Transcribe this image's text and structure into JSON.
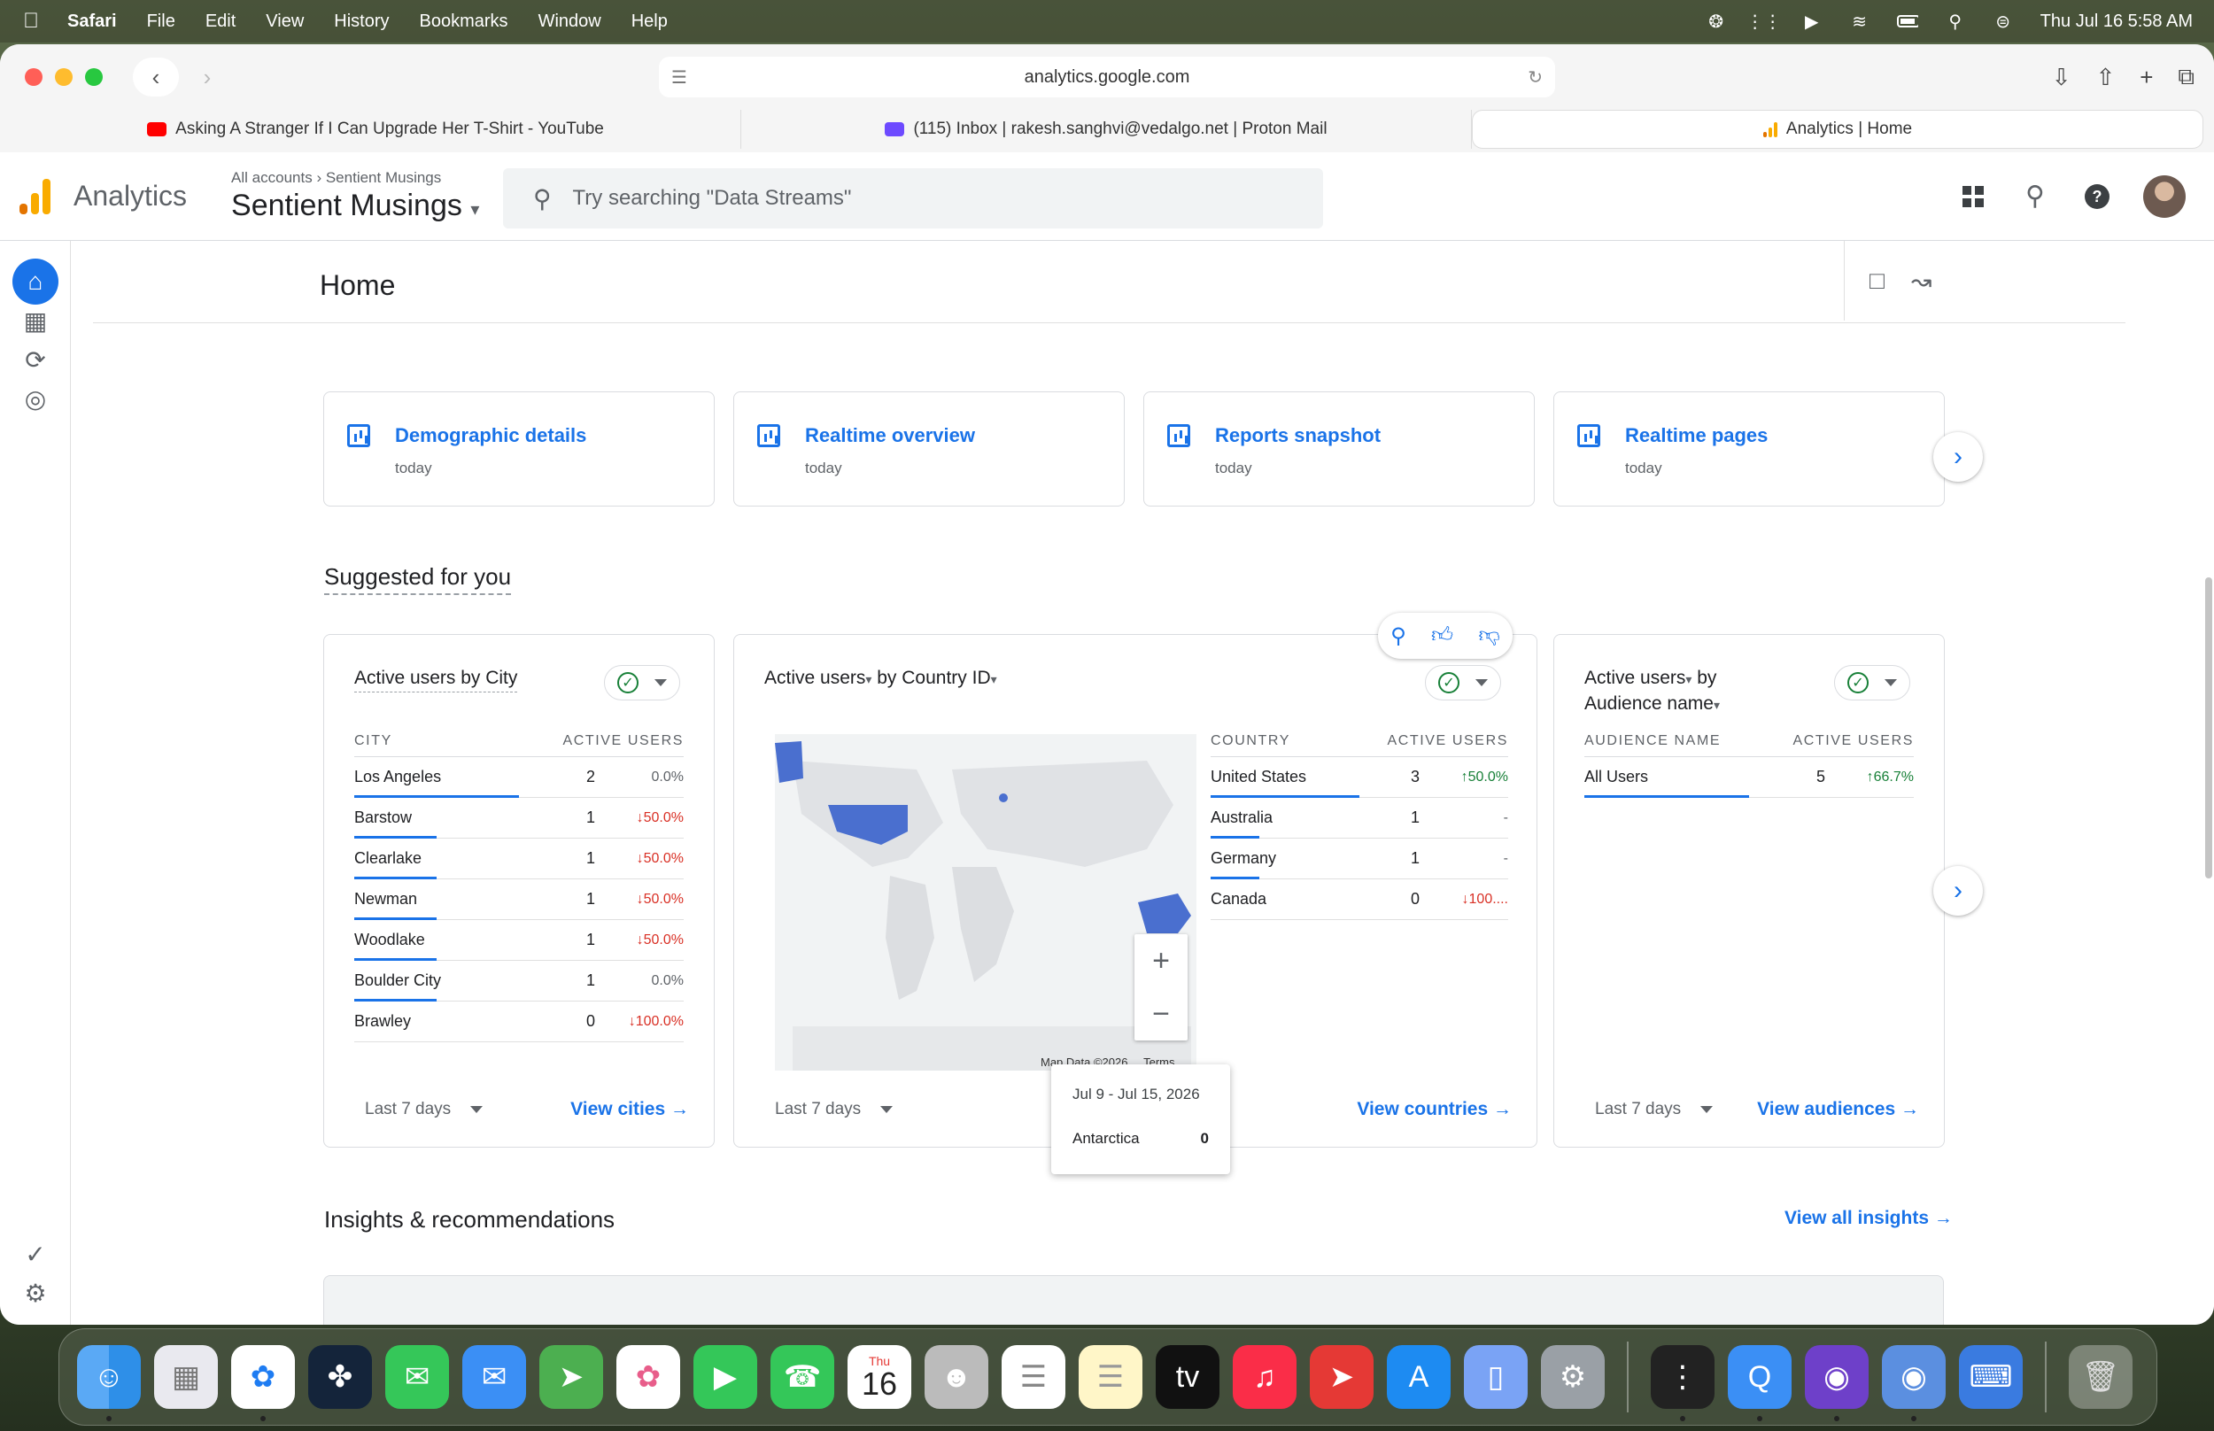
{
  "menubar": {
    "app": "Safari",
    "items": [
      "File",
      "Edit",
      "View",
      "History",
      "Bookmarks",
      "Window",
      "Help"
    ],
    "clock": "Thu Jul 16  5:58 AM"
  },
  "browser": {
    "url": "analytics.google.com",
    "tabs": [
      {
        "title": "Asking A Stranger If I Can Upgrade Her T-Shirt - YouTube",
        "icon": "youtube-icon",
        "color": "#ff0000"
      },
      {
        "title": "(115) Inbox | rakesh.sanghvi@vedalgo.net | Proton Mail",
        "icon": "proton-mail-icon",
        "color": "#6d4aff"
      },
      {
        "title": "Analytics | Home",
        "icon": "analytics-icon",
        "color": "#f9ab00"
      }
    ]
  },
  "header": {
    "product": "Analytics",
    "crumb_all": "All accounts",
    "crumb_account": "Sentient Musings",
    "property": "Sentient Musings",
    "search_placeholder": "Try searching \"Data Streams\""
  },
  "home": {
    "title": "Home",
    "quick_cards": [
      {
        "title": "Demographic details",
        "sub": "today"
      },
      {
        "title": "Realtime overview",
        "sub": "today"
      },
      {
        "title": "Reports snapshot",
        "sub": "today"
      },
      {
        "title": "Realtime pages",
        "sub": "today"
      }
    ],
    "suggested_title": "Suggested for you",
    "city_card": {
      "title": "Active users by City",
      "col1": "CITY",
      "col2": "ACTIVE USERS",
      "rows": [
        {
          "name": "Los Angeles",
          "value": "2",
          "change": "0.0%",
          "dir": "neutral",
          "share": 1.0
        },
        {
          "name": "Barstow",
          "value": "1",
          "change": "↓50.0%",
          "dir": "down",
          "share": 0.5
        },
        {
          "name": "Clearlake",
          "value": "1",
          "change": "↓50.0%",
          "dir": "down",
          "share": 0.5
        },
        {
          "name": "Newman",
          "value": "1",
          "change": "↓50.0%",
          "dir": "down",
          "share": 0.5
        },
        {
          "name": "Woodlake",
          "value": "1",
          "change": "↓50.0%",
          "dir": "down",
          "share": 0.5
        },
        {
          "name": "Boulder City",
          "value": "1",
          "change": "0.0%",
          "dir": "neutral",
          "share": 0.5
        },
        {
          "name": "Brawley",
          "value": "0",
          "change": "↓100.0%",
          "dir": "down",
          "share": 0
        }
      ],
      "range": "Last 7 days",
      "link": "View cities"
    },
    "country_card": {
      "title_metric": "Active users",
      "title_dim": "by Country ID",
      "col1": "COUNTRY",
      "col2": "ACTIVE USERS",
      "rows": [
        {
          "name": "United States",
          "value": "3",
          "change": "↑50.0%",
          "dir": "up",
          "share": 1.0
        },
        {
          "name": "Australia",
          "value": "1",
          "change": "-",
          "dir": "neutral",
          "share": 0.33
        },
        {
          "name": "Germany",
          "value": "1",
          "change": "-",
          "dir": "neutral",
          "share": 0.33
        },
        {
          "name": "Canada",
          "value": "0",
          "change": "↓100....",
          "dir": "down",
          "share": 0
        }
      ],
      "map_attribution": "Map Data ©2026",
      "map_terms": "Terms",
      "tooltip_dates": "Jul 9 - Jul 15, 2026",
      "tooltip_region": "Antarctica",
      "tooltip_value": "0",
      "range": "Last 7 days",
      "link": "View countries"
    },
    "audience_card": {
      "title_metric": "Active users",
      "title_dim": "by",
      "title_dim2": "Audience name",
      "col1": "AUDIENCE NAME",
      "col2": "ACTIVE USERS",
      "rows": [
        {
          "name": "All Users",
          "value": "5",
          "change": "↑66.7%",
          "dir": "up",
          "share": 1.0
        }
      ],
      "range": "Last 7 days",
      "link": "View audiences"
    },
    "insights_title": "Insights & recommendations",
    "insights_link": "View all insights"
  },
  "dock": {
    "calendar_month": "Thu",
    "calendar_day": "16"
  },
  "colors": {
    "accent": "#1a73e8",
    "map_highlight": "#4a6fcf",
    "up": "#188038",
    "down": "#d93025"
  }
}
